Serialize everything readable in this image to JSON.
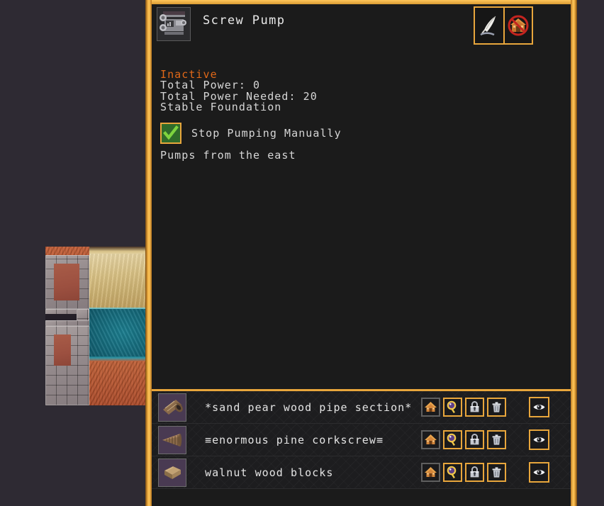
{
  "window": {
    "background_color": "#2e2a33",
    "panel_background": "#1b1b1b",
    "accent_color": "#e8a63c",
    "status_color": "#e06818"
  },
  "map": {
    "name": "fortress-map-view",
    "terrain_legend": [
      {
        "name": "rock",
        "color": "#c4613a"
      },
      {
        "name": "sand",
        "color": "#d9c184"
      },
      {
        "name": "water",
        "color": "#15697a"
      },
      {
        "name": "stone-floor",
        "color": "#948a8c"
      }
    ]
  },
  "header": {
    "icon": "screw-pump-icon",
    "title": "Screw Pump",
    "buttons": [
      {
        "name": "rename-button",
        "icon": "quill-pen-icon",
        "label": ""
      },
      {
        "name": "remove-building-button",
        "icon": "no-building-icon",
        "label": ""
      }
    ]
  },
  "info": {
    "status": "Inactive",
    "lines": [
      "Total Power: 0",
      "Total Power Needed: 20",
      "Stable Foundation"
    ],
    "checkbox": {
      "label": "Stop Pumping Manually",
      "checked": true,
      "check_color": "#7ed43f"
    },
    "direction": "Pumps from the east"
  },
  "items": {
    "row_action_labels": {
      "home": "",
      "zoom": "",
      "lock": "",
      "trash": "",
      "eye": ""
    },
    "rows": [
      {
        "thumb": "wood-pipe-section-icon",
        "label": "*sand pear wood pipe section*",
        "actions": [
          {
            "name": "go-to-building-button",
            "icon": "house-icon",
            "enabled": false
          },
          {
            "name": "zoom-to-item-button",
            "icon": "magnifier-icon",
            "enabled": true
          },
          {
            "name": "lock-item-button",
            "icon": "lock-icon",
            "enabled": true
          },
          {
            "name": "delete-item-button",
            "icon": "trash-icon",
            "enabled": true
          }
        ],
        "eye": {
          "name": "view-item-button",
          "icon": "eye-icon"
        }
      },
      {
        "thumb": "corkscrew-icon",
        "label": "≡enormous pine corkscrew≡",
        "actions": [
          {
            "name": "go-to-building-button",
            "icon": "house-icon",
            "enabled": false
          },
          {
            "name": "zoom-to-item-button",
            "icon": "magnifier-icon",
            "enabled": true
          },
          {
            "name": "lock-item-button",
            "icon": "lock-icon",
            "enabled": true
          },
          {
            "name": "delete-item-button",
            "icon": "trash-icon",
            "enabled": true
          }
        ],
        "eye": {
          "name": "view-item-button",
          "icon": "eye-icon"
        }
      },
      {
        "thumb": "wood-block-icon",
        "label": "walnut wood blocks",
        "actions": [
          {
            "name": "go-to-building-button",
            "icon": "house-icon",
            "enabled": false
          },
          {
            "name": "zoom-to-item-button",
            "icon": "magnifier-icon",
            "enabled": true
          },
          {
            "name": "lock-item-button",
            "icon": "lock-icon",
            "enabled": true
          },
          {
            "name": "delete-item-button",
            "icon": "trash-icon",
            "enabled": true
          }
        ],
        "eye": {
          "name": "view-item-button",
          "icon": "eye-icon"
        }
      }
    ]
  }
}
